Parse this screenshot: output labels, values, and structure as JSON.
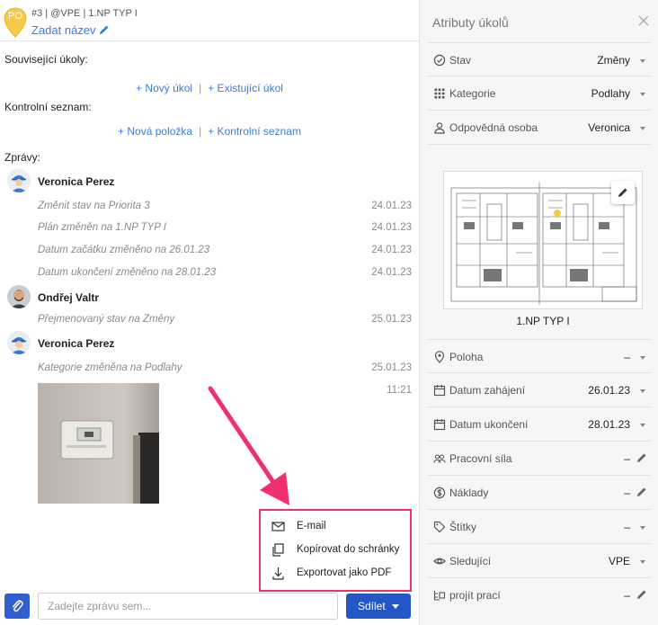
{
  "task": {
    "pin_label": "PO",
    "meta": "#3 | @VPE | 1.NP TYP I",
    "name_placeholder": "Zadat název"
  },
  "related_tasks": {
    "label": "Související úkoly:",
    "new_link": "+ Nový úkol",
    "existing_link": "+ Existující úkol",
    "separator": "|"
  },
  "checklist": {
    "label": "Kontrolní seznam:",
    "new_item_link": "+ Nová položka",
    "new_list_link": "+ Kontrolní seznam",
    "separator": "|"
  },
  "messages": {
    "label": "Zprávy:",
    "groups": [
      {
        "author": "Veronica Perez",
        "avatar": "worker-avatar-icon",
        "lines": [
          {
            "text": "Změnit stav na Priorita 3",
            "date": "24.01.23"
          },
          {
            "text": "Plán změněn na 1.NP TYP I",
            "date": "24.01.23"
          },
          {
            "text": "Datum začátku změněno na 26.01.23",
            "date": "24.01.23"
          },
          {
            "text": "Datum ukončení změněno na 28.01.23",
            "date": "24.01.23"
          }
        ]
      },
      {
        "author": "Ondřej Valtr",
        "avatar": "photo-avatar",
        "lines": [
          {
            "text": "Přejmenovaný stav na Změny",
            "date": "25.01.23"
          }
        ]
      },
      {
        "author": "Veronica Perez",
        "avatar": "worker-avatar-icon",
        "lines": [
          {
            "text": "Kategorie změněna na Podlahy",
            "date": "25.01.23"
          }
        ]
      }
    ],
    "photo_time": "11:21"
  },
  "share_menu": {
    "items": [
      {
        "label": "E-mail",
        "icon": "envelope-icon"
      },
      {
        "label": "Kopírovat do schránky",
        "icon": "copy-icon"
      },
      {
        "label": "Exportovat jako PDF",
        "icon": "download-icon"
      }
    ],
    "highlight_color": "#f0306e"
  },
  "composer": {
    "placeholder": "Zadejte zprávu sem...",
    "share_label": "Sdílet"
  },
  "attributes": {
    "title": "Atributy úkolů",
    "top_rows": [
      {
        "label": "Stav",
        "value": "Změny",
        "icon": "check-circle-icon"
      },
      {
        "label": "Kategorie",
        "value": "Podlahy",
        "icon": "grid-icon"
      },
      {
        "label": "Odpovědná osoba",
        "value": "Veronica",
        "icon": "person-icon"
      }
    ],
    "plan_caption": "1.NP TYP I",
    "bottom_rows": [
      {
        "label": "Poloha",
        "value": "–",
        "icon": "location-pin-icon",
        "control": "caret"
      },
      {
        "label": "Datum zahájení",
        "value": "26.01.23",
        "icon": "calendar-icon",
        "control": "caret"
      },
      {
        "label": "Datum ukončení",
        "value": "28.01.23",
        "icon": "calendar-icon",
        "control": "caret"
      },
      {
        "label": "Pracovní síla",
        "value": "–",
        "icon": "people-icon",
        "control": "pencil"
      },
      {
        "label": "Náklady",
        "value": "–",
        "icon": "dollar-circle-icon",
        "control": "pencil"
      },
      {
        "label": "Štítky",
        "value": "–",
        "icon": "tag-icon",
        "control": "caret"
      },
      {
        "label": "Sledující",
        "value": "VPE",
        "icon": "eye-icon",
        "control": "caret"
      },
      {
        "label": "projít prací",
        "value": "–",
        "icon": "checklist-icon",
        "control": "pencil"
      }
    ]
  },
  "colors": {
    "accent": "#2457c6",
    "link": "#3b7dd8",
    "pin": "#f7c948"
  }
}
